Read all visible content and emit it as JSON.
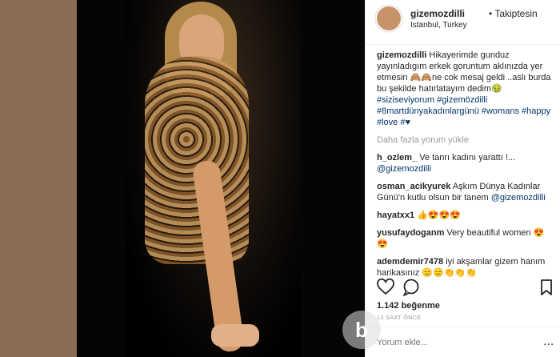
{
  "post": {
    "username": "gizemozdilli",
    "separator_follow": "• Takiptesin",
    "location": "Istanbul, Turkey"
  },
  "caption": {
    "username": "gizemozdilli",
    "text": "Hikayerimde gunduz yayınladıgım erkek goruntum aklınızda yer etmesin 🙈🙈ne cok mesaj geldi ..aslı burda bu şekilde hatırlatayım dedim🤢",
    "hashtags": "#siziseviyorum #gizemözdilli #8martdünyakadınlargünü #womans #happy #love #♥"
  },
  "load_more": "Daha fazla yorum yükle",
  "comments": [
    {
      "user": "h_ozlem_",
      "text": "Ve tanrı kadını yarattı !...",
      "mention": "@gizemozdilli"
    },
    {
      "user": "osman_acikyurek",
      "text": "Aşkım Dünya Kadınlar Günü'n kutlu olsun bir tanem",
      "mention": "@gizemozdilli"
    },
    {
      "user": "hayatxx1",
      "text": "👍😍😍😍",
      "mention": ""
    },
    {
      "user": "yusufaydoganm",
      "text": "Very beautiful women 😍 😍",
      "mention": ""
    },
    {
      "user": "ademdemir7478",
      "text": "iyi akşamlar gizem hanım harikasınız 😑😑👏👏👏",
      "mention": ""
    }
  ],
  "likes": "1.142 beğenme",
  "time": "13 SAAT ÖNCE",
  "add_comment": {
    "placeholder": "Yorum ekle..."
  },
  "more_options": "...",
  "watermark": "b",
  "icons": {
    "like": "heart-icon",
    "comment": "comment-icon",
    "save": "bookmark-icon"
  },
  "colors": {
    "link": "#003569",
    "text": "#262626",
    "muted": "#999999"
  }
}
